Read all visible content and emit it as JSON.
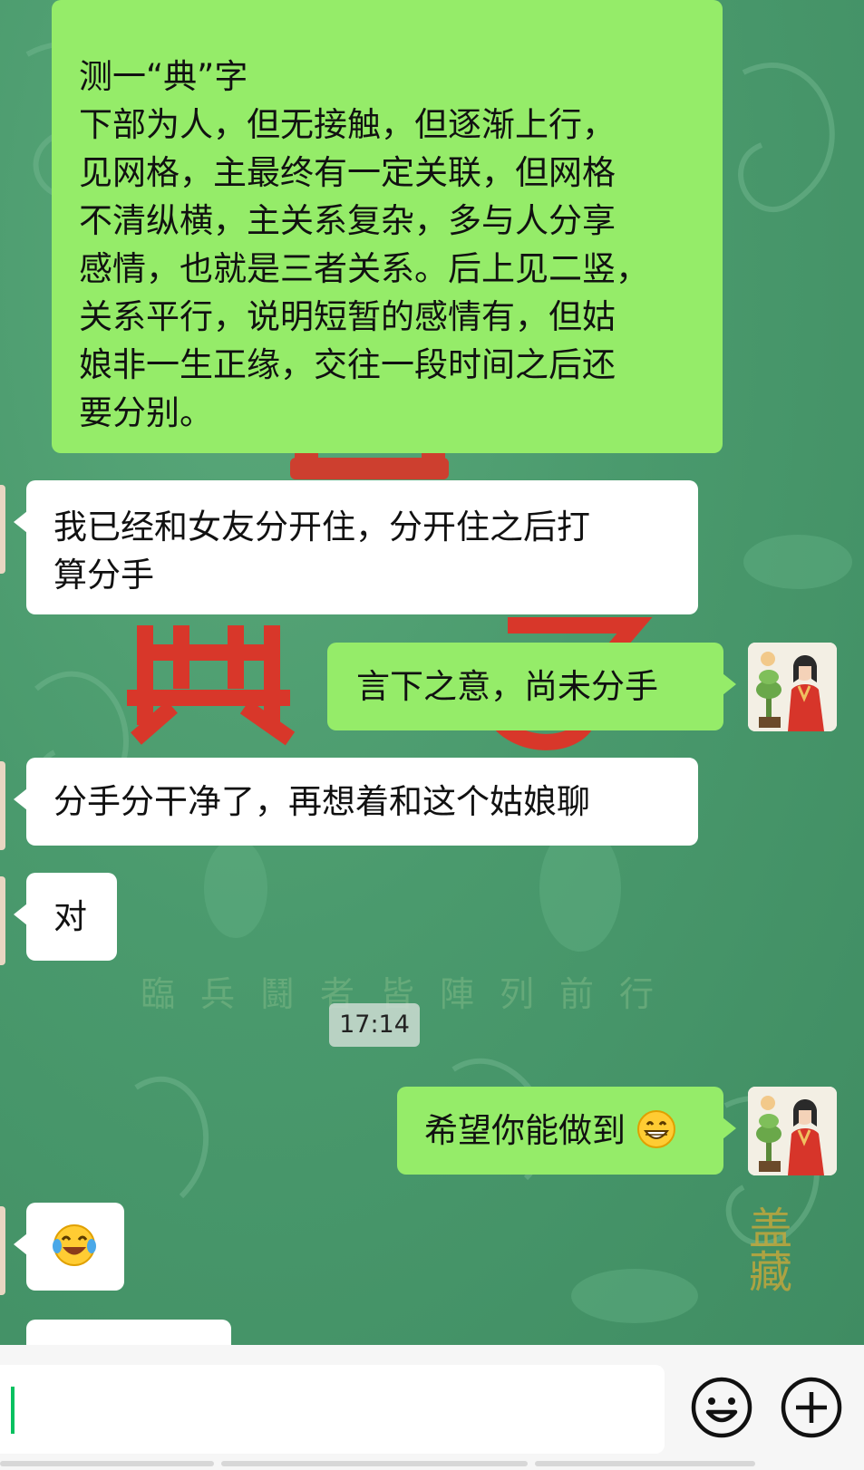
{
  "messages": [
    {
      "side": "out",
      "lines": [
        "测一“典”字",
        "下部为人，但无接触，但逐渐上行，",
        "见网格，主最终有一定关联，但网格",
        "不清纵横，主关系复杂，多与人分享",
        "感情，也就是三者关系。后上见二竖，",
        "关系平行，说明短暂的感情有，但姑",
        "娘非一生正缘，交往一段时间之后还",
        "要分别。"
      ]
    },
    {
      "side": "in",
      "lines": [
        "我已经和女友分开住，分开住之后打",
        "算分手"
      ]
    },
    {
      "side": "out",
      "text": "言下之意，尚未分手"
    },
    {
      "side": "in",
      "text": "分手分干净了，再想着和这个姑娘聊"
    },
    {
      "side": "in",
      "text": "对"
    },
    {
      "side": "out",
      "text": "希望你能做到",
      "emoji": "grinning-face"
    },
    {
      "side": "in",
      "emoji": "face-with-tears-of-joy"
    }
  ],
  "timestamp": "17:14",
  "background": {
    "poem": "臨兵鬪者皆陣列前行",
    "seal": "盖藏",
    "big_glyph": "典"
  },
  "colors": {
    "chat_bg": "#4a9a6e",
    "bubble_out": "#95ec69",
    "bubble_in": "#ffffff",
    "caret": "#07c160",
    "seal_red": "#d8372a"
  },
  "input_bar": {
    "value": "",
    "icons": [
      "emoji-icon",
      "plus-icon"
    ]
  }
}
